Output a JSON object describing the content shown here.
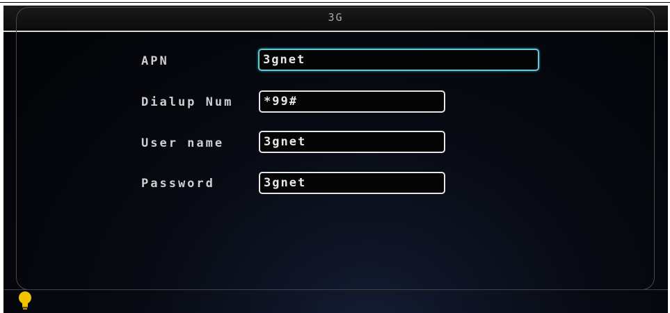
{
  "window": {
    "title": "3G"
  },
  "form": {
    "apn": {
      "label": "APN",
      "value": "3gnet"
    },
    "dialup": {
      "label": "Dialup Num",
      "value": "*99#"
    },
    "username": {
      "label": "User name",
      "value": "3gnet"
    },
    "password": {
      "label": "Password",
      "value": "3gnet"
    }
  },
  "status": {
    "icon": "lightbulb-icon"
  },
  "colors": {
    "focus_border": "#5fc9d8",
    "bulb": "#f2c300"
  }
}
